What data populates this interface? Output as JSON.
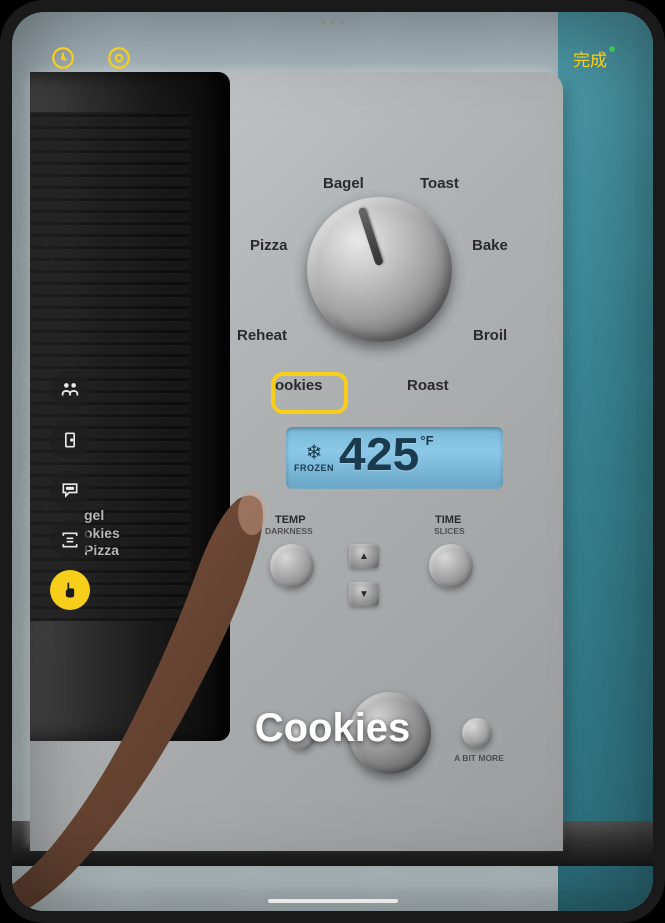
{
  "done_label": "完成",
  "caption": "Cookies",
  "dial_labels": {
    "bagel": "Bagel",
    "toast": "Toast",
    "pizza": "Pizza",
    "bake": "Bake",
    "reheat": "Reheat",
    "broil": "Broil",
    "cookies": "ookies",
    "roast": "Roast"
  },
  "lcd": {
    "frozen_label": "FROZEN",
    "temp_value": "425",
    "temp_unit": "°F"
  },
  "controls": {
    "temp_label": "TEMP",
    "darkness_label": "DARKNESS",
    "time_label": "TIME",
    "slices_label": "SLICES",
    "a_bit_more": "A BIT MORE"
  },
  "glass_menu": [
    "gel",
    "okies",
    "Pizza"
  ]
}
